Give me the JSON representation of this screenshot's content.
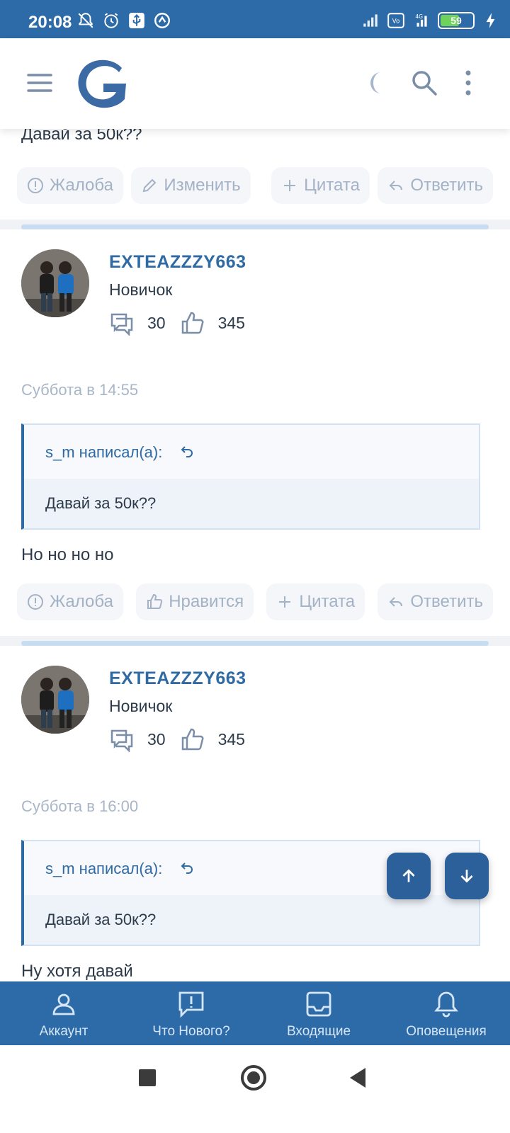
{
  "status_bar": {
    "time": "20:08",
    "battery": "59",
    "battery_level": 0.59,
    "network": "4G"
  },
  "app_bar": {
    "logo_icon": "forum-logo",
    "menu_icon": "hamburger-icon",
    "theme_icon": "moon-icon",
    "search_icon": "search-icon",
    "more_icon": "more-vertical-icon"
  },
  "top_post": {
    "text": "Давай за 50к??",
    "actions": [
      "Жалоба",
      "Изменить",
      "Цитата",
      "Ответить"
    ]
  },
  "posts": [
    {
      "username": "EXTEAZZZY663",
      "role": "Новичок",
      "messages": "30",
      "likes": "345",
      "date": "Суббота в 14:55",
      "quote_author": "s_m написал(а):",
      "quote_text": "Давай за 50к??",
      "text": "Но но но но",
      "actions": [
        "Жалоба",
        "Нравится",
        "Цитата",
        "Ответить"
      ]
    },
    {
      "username": "EXTEAZZZY663",
      "role": "Новичок",
      "messages": "30",
      "likes": "345",
      "date": "Суббота в 16:00",
      "quote_author": "s_m написал(а):",
      "quote_text": "Давай за 50к??",
      "text": "Ну хотя давай"
    }
  ],
  "bottom_nav": [
    {
      "label": "Аккаунт",
      "icon": "account-icon"
    },
    {
      "label": "Что Нового?",
      "icon": "whats-new-icon"
    },
    {
      "label": "Входящие",
      "icon": "inbox-icon"
    },
    {
      "label": "Оповещения",
      "icon": "bell-icon"
    }
  ],
  "colors": {
    "primary": "#2c6aa8",
    "link": "#2f6aa3",
    "muted": "#a4b2c6",
    "quote_bg": "#eef3fa"
  }
}
